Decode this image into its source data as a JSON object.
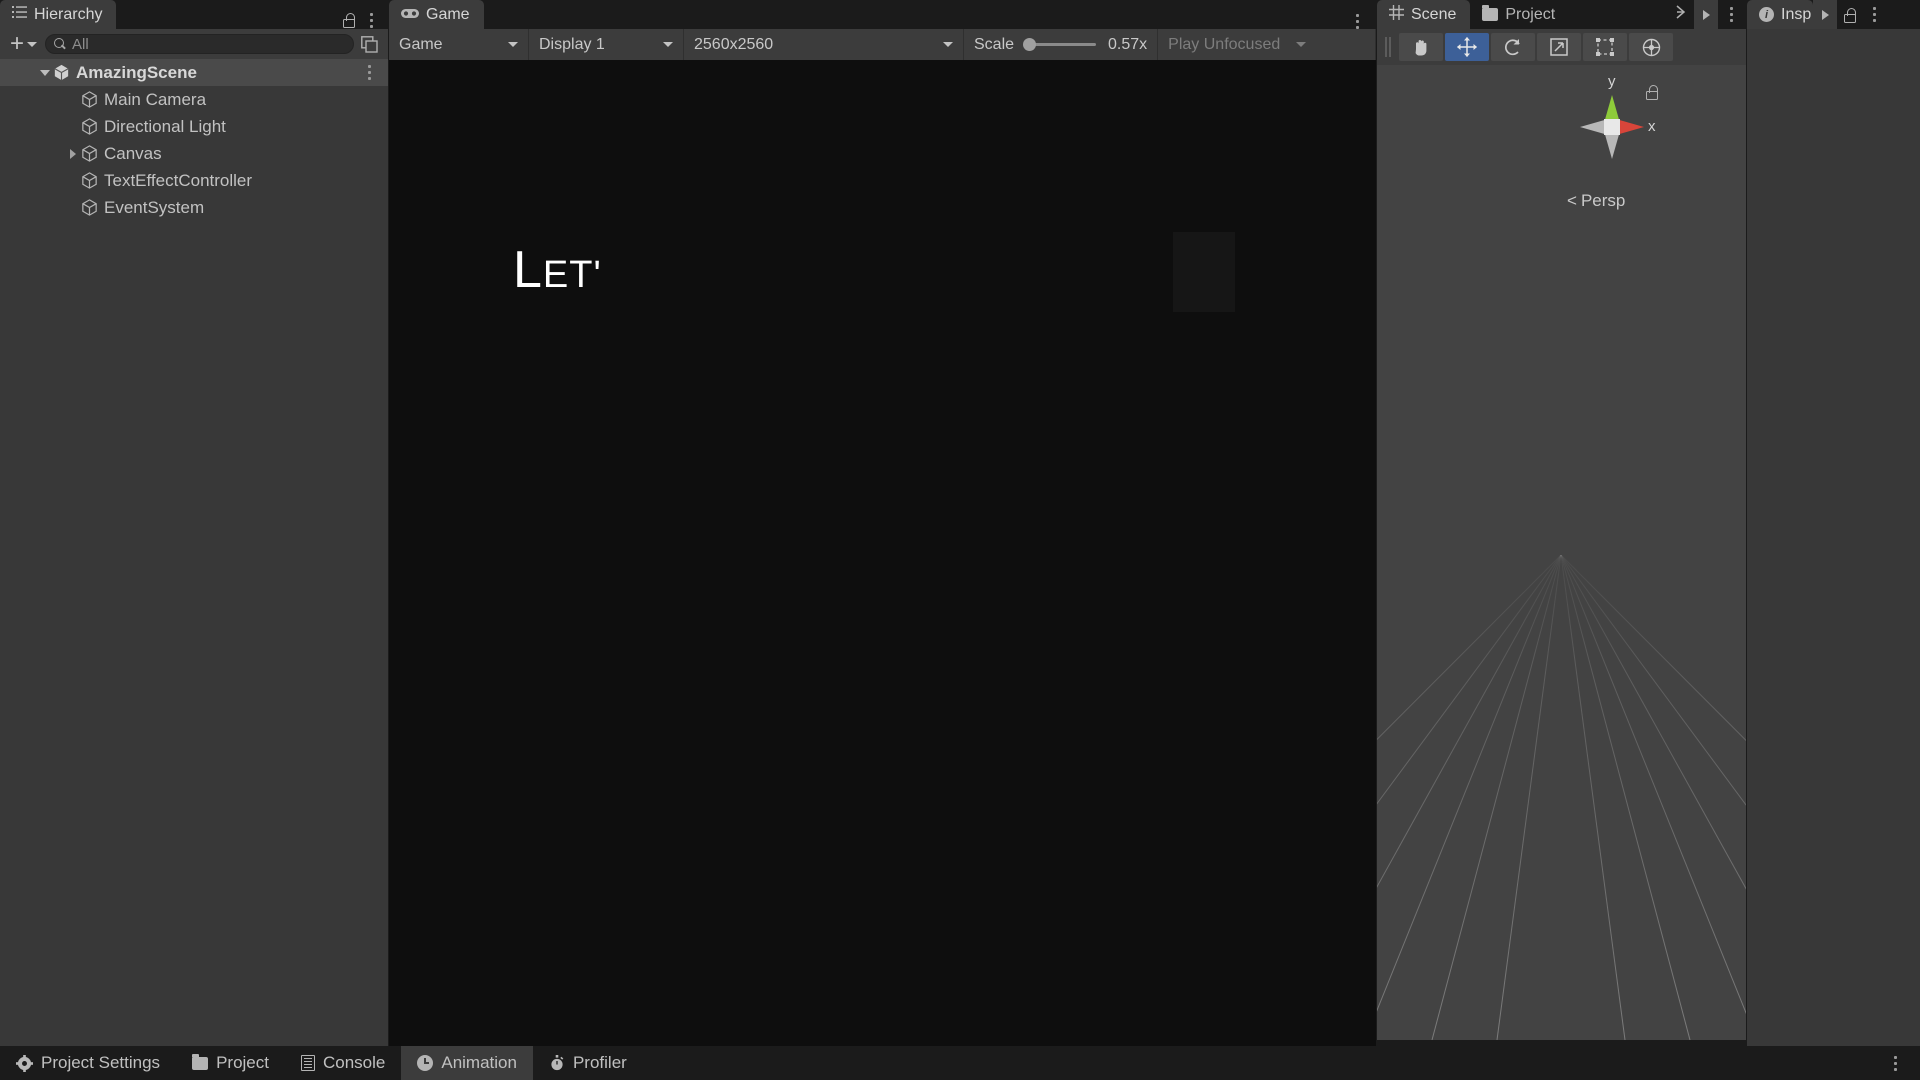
{
  "hierarchy": {
    "tab_label": "Hierarchy",
    "tab_icon": "list-icon",
    "lock_icon": "lock-open-icon",
    "menu_icon": "kebab-menu-icon",
    "toolbar": {
      "add_label": "+",
      "add_icon": "plus-icon",
      "add_dropdown_icon": "chevron-down-icon",
      "search_placeholder": "All",
      "search_value": "",
      "search_icon": "search-icon",
      "expand_icon": "open-in-new-icon"
    },
    "items": [
      {
        "label": "AmazingScene",
        "icon": "unity-scene-icon",
        "depth": 0,
        "twisty": "down",
        "selected": true,
        "bold": true,
        "kebab": true
      },
      {
        "label": "Main Camera",
        "icon": "gameobject-cube-icon",
        "depth": 1,
        "twisty": "none",
        "selected": false,
        "bold": false,
        "kebab": false
      },
      {
        "label": "Directional Light",
        "icon": "gameobject-cube-icon",
        "depth": 1,
        "twisty": "none",
        "selected": false,
        "bold": false,
        "kebab": false
      },
      {
        "label": "Canvas",
        "icon": "gameobject-cube-icon",
        "depth": 1,
        "twisty": "right",
        "selected": false,
        "bold": false,
        "kebab": false
      },
      {
        "label": "TextEffectController",
        "icon": "gameobject-cube-icon",
        "depth": 1,
        "twisty": "none",
        "selected": false,
        "bold": false,
        "kebab": false
      },
      {
        "label": "EventSystem",
        "icon": "gameobject-cube-icon",
        "depth": 1,
        "twisty": "none",
        "selected": false,
        "bold": false,
        "kebab": false
      }
    ]
  },
  "game": {
    "tab_label": "Game",
    "tab_icon": "gamepad-icon",
    "menu_icon": "kebab-menu-icon",
    "toolbar": {
      "view_mode": "Game",
      "display": "Display 1",
      "resolution": "2560x2560",
      "scale_label": "Scale",
      "scale_value": "0.57x",
      "scale_fraction": 0,
      "play_mode": "Play Unfocused",
      "dropdown_icon": "chevron-down-icon"
    },
    "canvas": {
      "text_first": "L",
      "text_rest": "ET'",
      "background_color": "#0e0e0e",
      "text_color": "#ffffff"
    }
  },
  "scene": {
    "tabs": [
      {
        "label": "Scene",
        "icon": "grid-icon",
        "active": true
      },
      {
        "label": "Project",
        "icon": "folder-icon",
        "active": false
      }
    ],
    "header_icons": [
      "pivot-icon",
      "play-arrow-icon",
      "kebab-menu-icon"
    ],
    "tools": [
      {
        "name": "hand-tool",
        "icon": "hand-icon",
        "selected": false
      },
      {
        "name": "move-tool",
        "icon": "move-arrows-icon",
        "selected": true
      },
      {
        "name": "rotate-tool",
        "icon": "rotate-icon",
        "selected": false
      },
      {
        "name": "scale-tool",
        "icon": "scale-icon",
        "selected": false
      },
      {
        "name": "rect-tool",
        "icon": "rect-transform-icon",
        "selected": false
      },
      {
        "name": "transform-tool",
        "icon": "transform-icon",
        "selected": false
      }
    ],
    "gizmo": {
      "axis_y_label": "y",
      "axis_x_label": "x",
      "projection_label": "Persp",
      "projection_prefix": "<",
      "color_x": "#d8453a",
      "color_y": "#8ecb3a",
      "color_z": "#b8b8b8"
    },
    "lock_icon": "lock-open-icon",
    "background_color": "#434343"
  },
  "inspector": {
    "tab_label": "Insp",
    "tab_icon": "info-icon",
    "play_icon": "play-arrow-icon",
    "lock_icon": "lock-open-icon",
    "menu_icon": "kebab-menu-icon"
  },
  "bottombar": {
    "items": [
      {
        "label": "Project Settings",
        "icon": "gear-icon",
        "active": false
      },
      {
        "label": "Project",
        "icon": "folder-icon",
        "active": false
      },
      {
        "label": "Console",
        "icon": "console-icon",
        "active": false
      },
      {
        "label": "Animation",
        "icon": "clock-icon",
        "active": true
      },
      {
        "label": "Profiler",
        "icon": "stopwatch-icon",
        "active": false
      }
    ],
    "menu_icon": "kebab-menu-icon"
  }
}
